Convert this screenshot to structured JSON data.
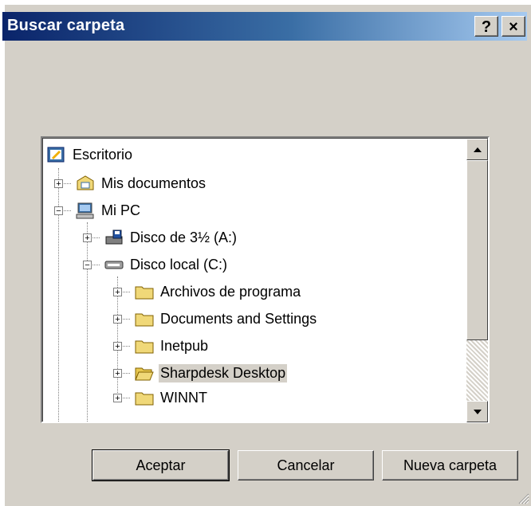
{
  "window": {
    "title": "Buscar carpeta",
    "help_glyph": "?",
    "close_glyph": "×"
  },
  "tree": {
    "items": [
      {
        "label": "Escritorio",
        "icon": "desktop-icon",
        "expander": ""
      },
      {
        "label": "Mis documentos",
        "icon": "my-documents-icon",
        "expander": "+"
      },
      {
        "label": "Mi PC",
        "icon": "my-computer-icon",
        "expander": "−"
      },
      {
        "label": "Disco de 3½ (A:)",
        "icon": "floppy-drive-icon",
        "expander": "+"
      },
      {
        "label": "Disco local (C:)",
        "icon": "hard-drive-icon",
        "expander": "−"
      },
      {
        "label": "Archivos de programa",
        "icon": "folder-icon",
        "expander": "+"
      },
      {
        "label": "Documents and Settings",
        "icon": "folder-icon",
        "expander": "+"
      },
      {
        "label": "Inetpub",
        "icon": "folder-icon",
        "expander": "+"
      },
      {
        "label": "Sharpdesk Desktop",
        "icon": "folder-open-icon",
        "expander": "+",
        "selected": true
      },
      {
        "label": "WINNT",
        "icon": "folder-icon",
        "expander": "+"
      }
    ]
  },
  "buttons": {
    "ok": "Aceptar",
    "cancel": "Cancelar",
    "new_folder": "Nueva carpeta"
  },
  "colors": {
    "title_active_start": "#0a246a",
    "title_active_end": "#a6caf0",
    "face": "#d4d0c8",
    "folder": "#f0d878"
  }
}
